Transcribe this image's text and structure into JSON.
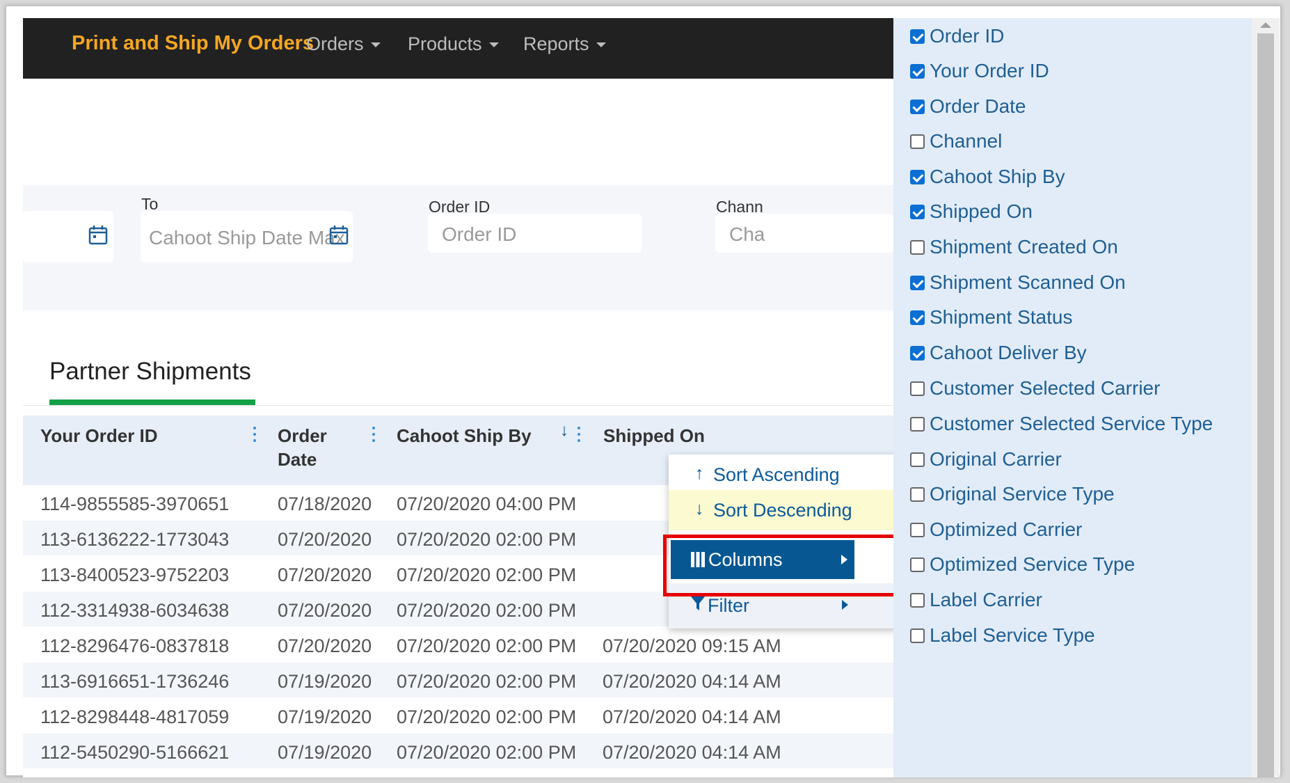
{
  "navbar": {
    "brand": "Print and Ship My Orders",
    "items": [
      "Orders",
      "Products",
      "Reports"
    ]
  },
  "filters": {
    "to_label": "To",
    "to_placeholder": "Cahoot Ship Date Max",
    "order_id_label": "Order ID",
    "order_id_placeholder": "Order ID",
    "channel_label_partial": "Chann",
    "channel_placeholder_partial": "Cha"
  },
  "tab": {
    "title": "Partner Shipments"
  },
  "table": {
    "headers": {
      "your_order_id": "Your Order ID",
      "order_date_line1": "Order",
      "order_date_line2": "Date",
      "cahoot_ship_by": "Cahoot Ship By",
      "shipped_on": "Shipped On",
      "sort_indicator": "↓"
    },
    "rows": [
      {
        "your_order_id": "114-9855585-3970651",
        "order_date": "07/18/2020",
        "cahoot_ship_by": "07/20/2020 04:00 PM",
        "shipped_on": ""
      },
      {
        "your_order_id": "113-6136222-1773043",
        "order_date": "07/20/2020",
        "cahoot_ship_by": "07/20/2020 02:00 PM",
        "shipped_on": ""
      },
      {
        "your_order_id": "113-8400523-9752203",
        "order_date": "07/20/2020",
        "cahoot_ship_by": "07/20/2020 02:00 PM",
        "shipped_on": ""
      },
      {
        "your_order_id": "112-3314938-6034638",
        "order_date": "07/20/2020",
        "cahoot_ship_by": "07/20/2020 02:00 PM",
        "shipped_on": ""
      },
      {
        "your_order_id": "112-8296476-0837818",
        "order_date": "07/20/2020",
        "cahoot_ship_by": "07/20/2020 02:00 PM",
        "shipped_on": "07/20/2020 09:15 AM"
      },
      {
        "your_order_id": "113-6916651-1736246",
        "order_date": "07/19/2020",
        "cahoot_ship_by": "07/20/2020 02:00 PM",
        "shipped_on": "07/20/2020 04:14 AM"
      },
      {
        "your_order_id": "112-8298448-4817059",
        "order_date": "07/19/2020",
        "cahoot_ship_by": "07/20/2020 02:00 PM",
        "shipped_on": "07/20/2020 04:14 AM"
      },
      {
        "your_order_id": "112-5450290-5166621",
        "order_date": "07/19/2020",
        "cahoot_ship_by": "07/20/2020 02:00 PM",
        "shipped_on": "07/20/2020 04:14 AM"
      }
    ]
  },
  "context_menu": {
    "sort_ascending": "Sort Ascending",
    "sort_descending": "Sort Descending",
    "columns": "Columns",
    "filter": "Filter"
  },
  "column_chooser": [
    {
      "label": "Order ID",
      "checked": true
    },
    {
      "label": "Your Order ID",
      "checked": true
    },
    {
      "label": "Order Date",
      "checked": true
    },
    {
      "label": "Channel",
      "checked": false
    },
    {
      "label": "Cahoot Ship By",
      "checked": true
    },
    {
      "label": "Shipped On",
      "checked": true
    },
    {
      "label": "Shipment Created On",
      "checked": false
    },
    {
      "label": "Shipment Scanned On",
      "checked": true
    },
    {
      "label": "Shipment Status",
      "checked": true
    },
    {
      "label": "Cahoot Deliver By",
      "checked": true
    },
    {
      "label": "Customer Selected Carrier",
      "checked": false
    },
    {
      "label": "Customer Selected Service Type",
      "checked": false
    },
    {
      "label": "Original Carrier",
      "checked": false
    },
    {
      "label": "Original Service Type",
      "checked": false
    },
    {
      "label": "Optimized Carrier",
      "checked": false
    },
    {
      "label": "Optimized Service Type",
      "checked": false
    },
    {
      "label": "Label Carrier",
      "checked": false
    },
    {
      "label": "Label Service Type",
      "checked": false
    }
  ],
  "colors": {
    "brand": "#f5a623",
    "navbar_bg": "#212121",
    "tab_underline": "#14a046",
    "menu_active_bg": "#075892",
    "highlight_border": "#e60000",
    "checkbox_checked": "#0b6fd4"
  }
}
